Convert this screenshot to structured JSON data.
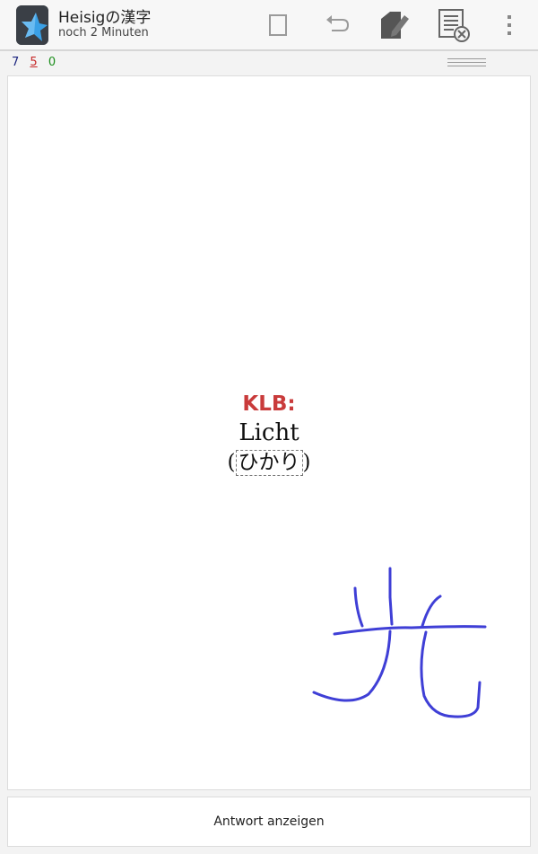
{
  "header": {
    "title": "Heisigの漢字",
    "subtitle": "noch 2 Minuten",
    "icons": [
      "anki-star-icon",
      "flag-icon",
      "undo-icon",
      "edit-icon",
      "bury-icon",
      "overflow-menu-icon"
    ]
  },
  "counts": {
    "new": "7",
    "learning": "5",
    "review": "0"
  },
  "card": {
    "label": "KLB:",
    "word": "Licht",
    "reading_open": "(",
    "reading": "ひかり",
    "reading_close": ")"
  },
  "answer_button": "Antwort anzeigen",
  "colors": {
    "label": "#c93b3b",
    "ink": "#3f3fd6",
    "new": "#1a237e",
    "learning": "#c62828",
    "review": "#1b8e1b"
  }
}
